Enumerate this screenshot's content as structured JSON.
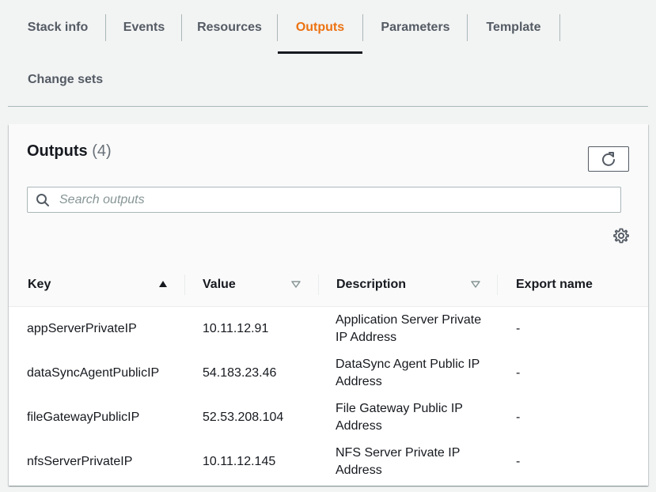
{
  "tabs": [
    {
      "label": "Stack info",
      "active": false
    },
    {
      "label": "Events",
      "active": false
    },
    {
      "label": "Resources",
      "active": false
    },
    {
      "label": "Outputs",
      "active": true
    },
    {
      "label": "Parameters",
      "active": false
    },
    {
      "label": "Template",
      "active": false
    },
    {
      "label": "Change sets",
      "active": false
    }
  ],
  "panel": {
    "title": "Outputs",
    "count": "(4)",
    "search_placeholder": "Search outputs"
  },
  "table": {
    "columns": [
      {
        "label": "Key",
        "sort": "ascending"
      },
      {
        "label": "Value",
        "sort": "sortable"
      },
      {
        "label": "Description",
        "sort": "sortable"
      },
      {
        "label": "Export name",
        "sort": "none"
      }
    ],
    "rows": [
      {
        "key": "appServerPrivateIP",
        "value": "10.11.12.91",
        "description": "Application Server Private IP Address",
        "export": "-"
      },
      {
        "key": "dataSyncAgentPublicIP",
        "value": "54.183.23.46",
        "description": "DataSync Agent Public IP Address",
        "export": "-"
      },
      {
        "key": "fileGatewayPublicIP",
        "value": "52.53.208.104",
        "description": "File Gateway Public IP Address",
        "export": "-"
      },
      {
        "key": "nfsServerPrivateIP",
        "value": "10.11.12.145",
        "description": "NFS Server Private IP Address",
        "export": "-"
      }
    ]
  },
  "colors": {
    "accent": "#ec7211",
    "text": "#16191f",
    "muted": "#545b64",
    "background": "#f2f3f3"
  },
  "icons": {
    "refresh": "refresh-icon",
    "search": "search-icon",
    "settings": "gear-icon",
    "sort_asc": "caret-up-icon",
    "sort_none": "caret-down-outline-icon"
  }
}
